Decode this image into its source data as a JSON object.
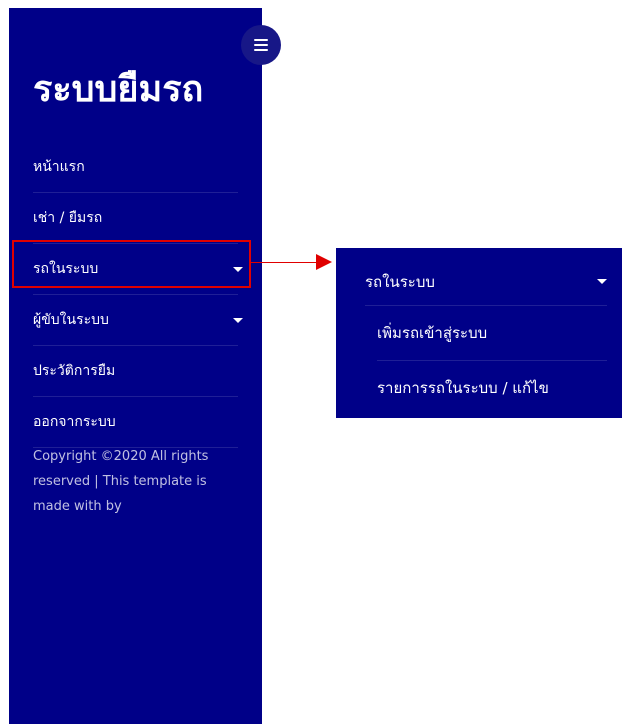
{
  "sidebar": {
    "brand": "ระบบยืมรถ",
    "items": [
      {
        "label": "หน้าแรก"
      },
      {
        "label": "เช่า / ยืมรถ"
      },
      {
        "label": "รถในระบบ"
      },
      {
        "label": "ผู้ขับในระบบ"
      },
      {
        "label": "ประวัติการยืม"
      },
      {
        "label": "ออกจากระบบ"
      }
    ],
    "copyright": "Copyright ©2020 All rights reserved | This template is made with by"
  },
  "submenu": {
    "title": "รถในระบบ",
    "items": [
      {
        "label": "เพิ่มรถเข้าสู่ระบบ"
      },
      {
        "label": "รายการรถในระบบ / แก้ไข"
      }
    ]
  },
  "colors": {
    "sidebar_bg": "#000088",
    "highlight": "#e00000",
    "toggle_bg": "#171787"
  },
  "icons": {
    "toggle": "hamburger-icon",
    "dropdown": "caret-down-icon",
    "pointer": "arrow-right-icon"
  }
}
